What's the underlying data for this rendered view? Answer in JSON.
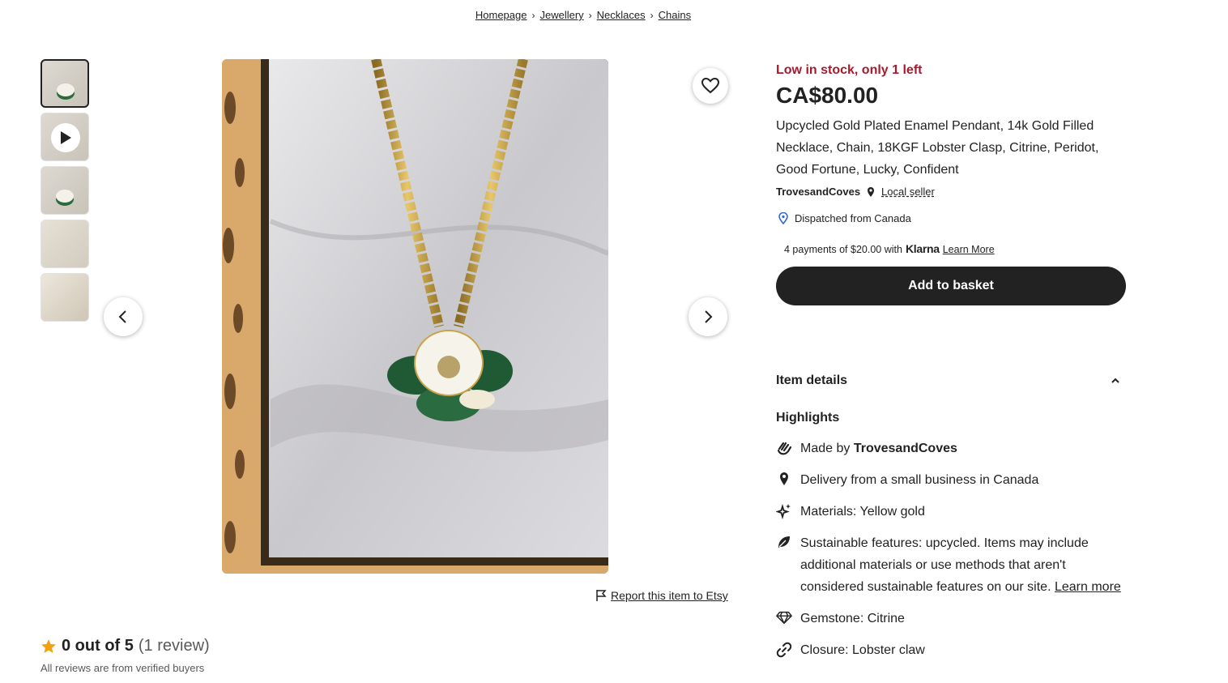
{
  "breadcrumb": [
    "Homepage",
    "Jewellery",
    "Necklaces",
    "Chains"
  ],
  "gallery": {
    "thumbnails": [
      {
        "alt": "Necklace photo 1",
        "active": true
      },
      {
        "alt": "Product video",
        "video": true
      },
      {
        "alt": "Necklace photo 3"
      },
      {
        "alt": "Necklace photo 4"
      },
      {
        "alt": "Necklace photo 5"
      }
    ]
  },
  "report": {
    "label": "Report this item to Etsy"
  },
  "reviews": {
    "score": "0 out of 5",
    "count": "(1 review)",
    "verified": "All reviews are from verified buyers"
  },
  "listing": {
    "stock": "Low in stock, only 1 left",
    "price": "CA$80.00",
    "title": "Upcycled Gold Plated Enamel Pendant, 14k Gold Filled Necklace, Chain, 18KGF Lobster Clasp, Citrine, Peridot, Good Fortune, Lucky, Confident",
    "seller_name": "TrovesandCoves",
    "local_seller": "Local seller",
    "dispatch": "Dispatched from Canada",
    "klarna_text": "4 payments of $20.00 with",
    "klarna_brand": "Klarna",
    "klarna_learn": "Learn More",
    "add_to_basket": "Add to basket"
  },
  "details": {
    "heading": "Item details",
    "highlights_heading": "Highlights",
    "made_by_prefix": "Made by",
    "made_by_name": "TrovesandCoves",
    "delivery": "Delivery from a small business in Canada",
    "materials": "Materials: Yellow gold",
    "sustainable": "Sustainable features: upcycled. Items may include additional materials or use methods that aren't considered sustainable features on our site.",
    "learn_more": "Learn more",
    "gemstone": "Gemstone: Citrine",
    "closure": "Closure: Lobster claw"
  },
  "colors": {
    "stock_red": "#a61a2e",
    "button_dark": "#222222"
  }
}
